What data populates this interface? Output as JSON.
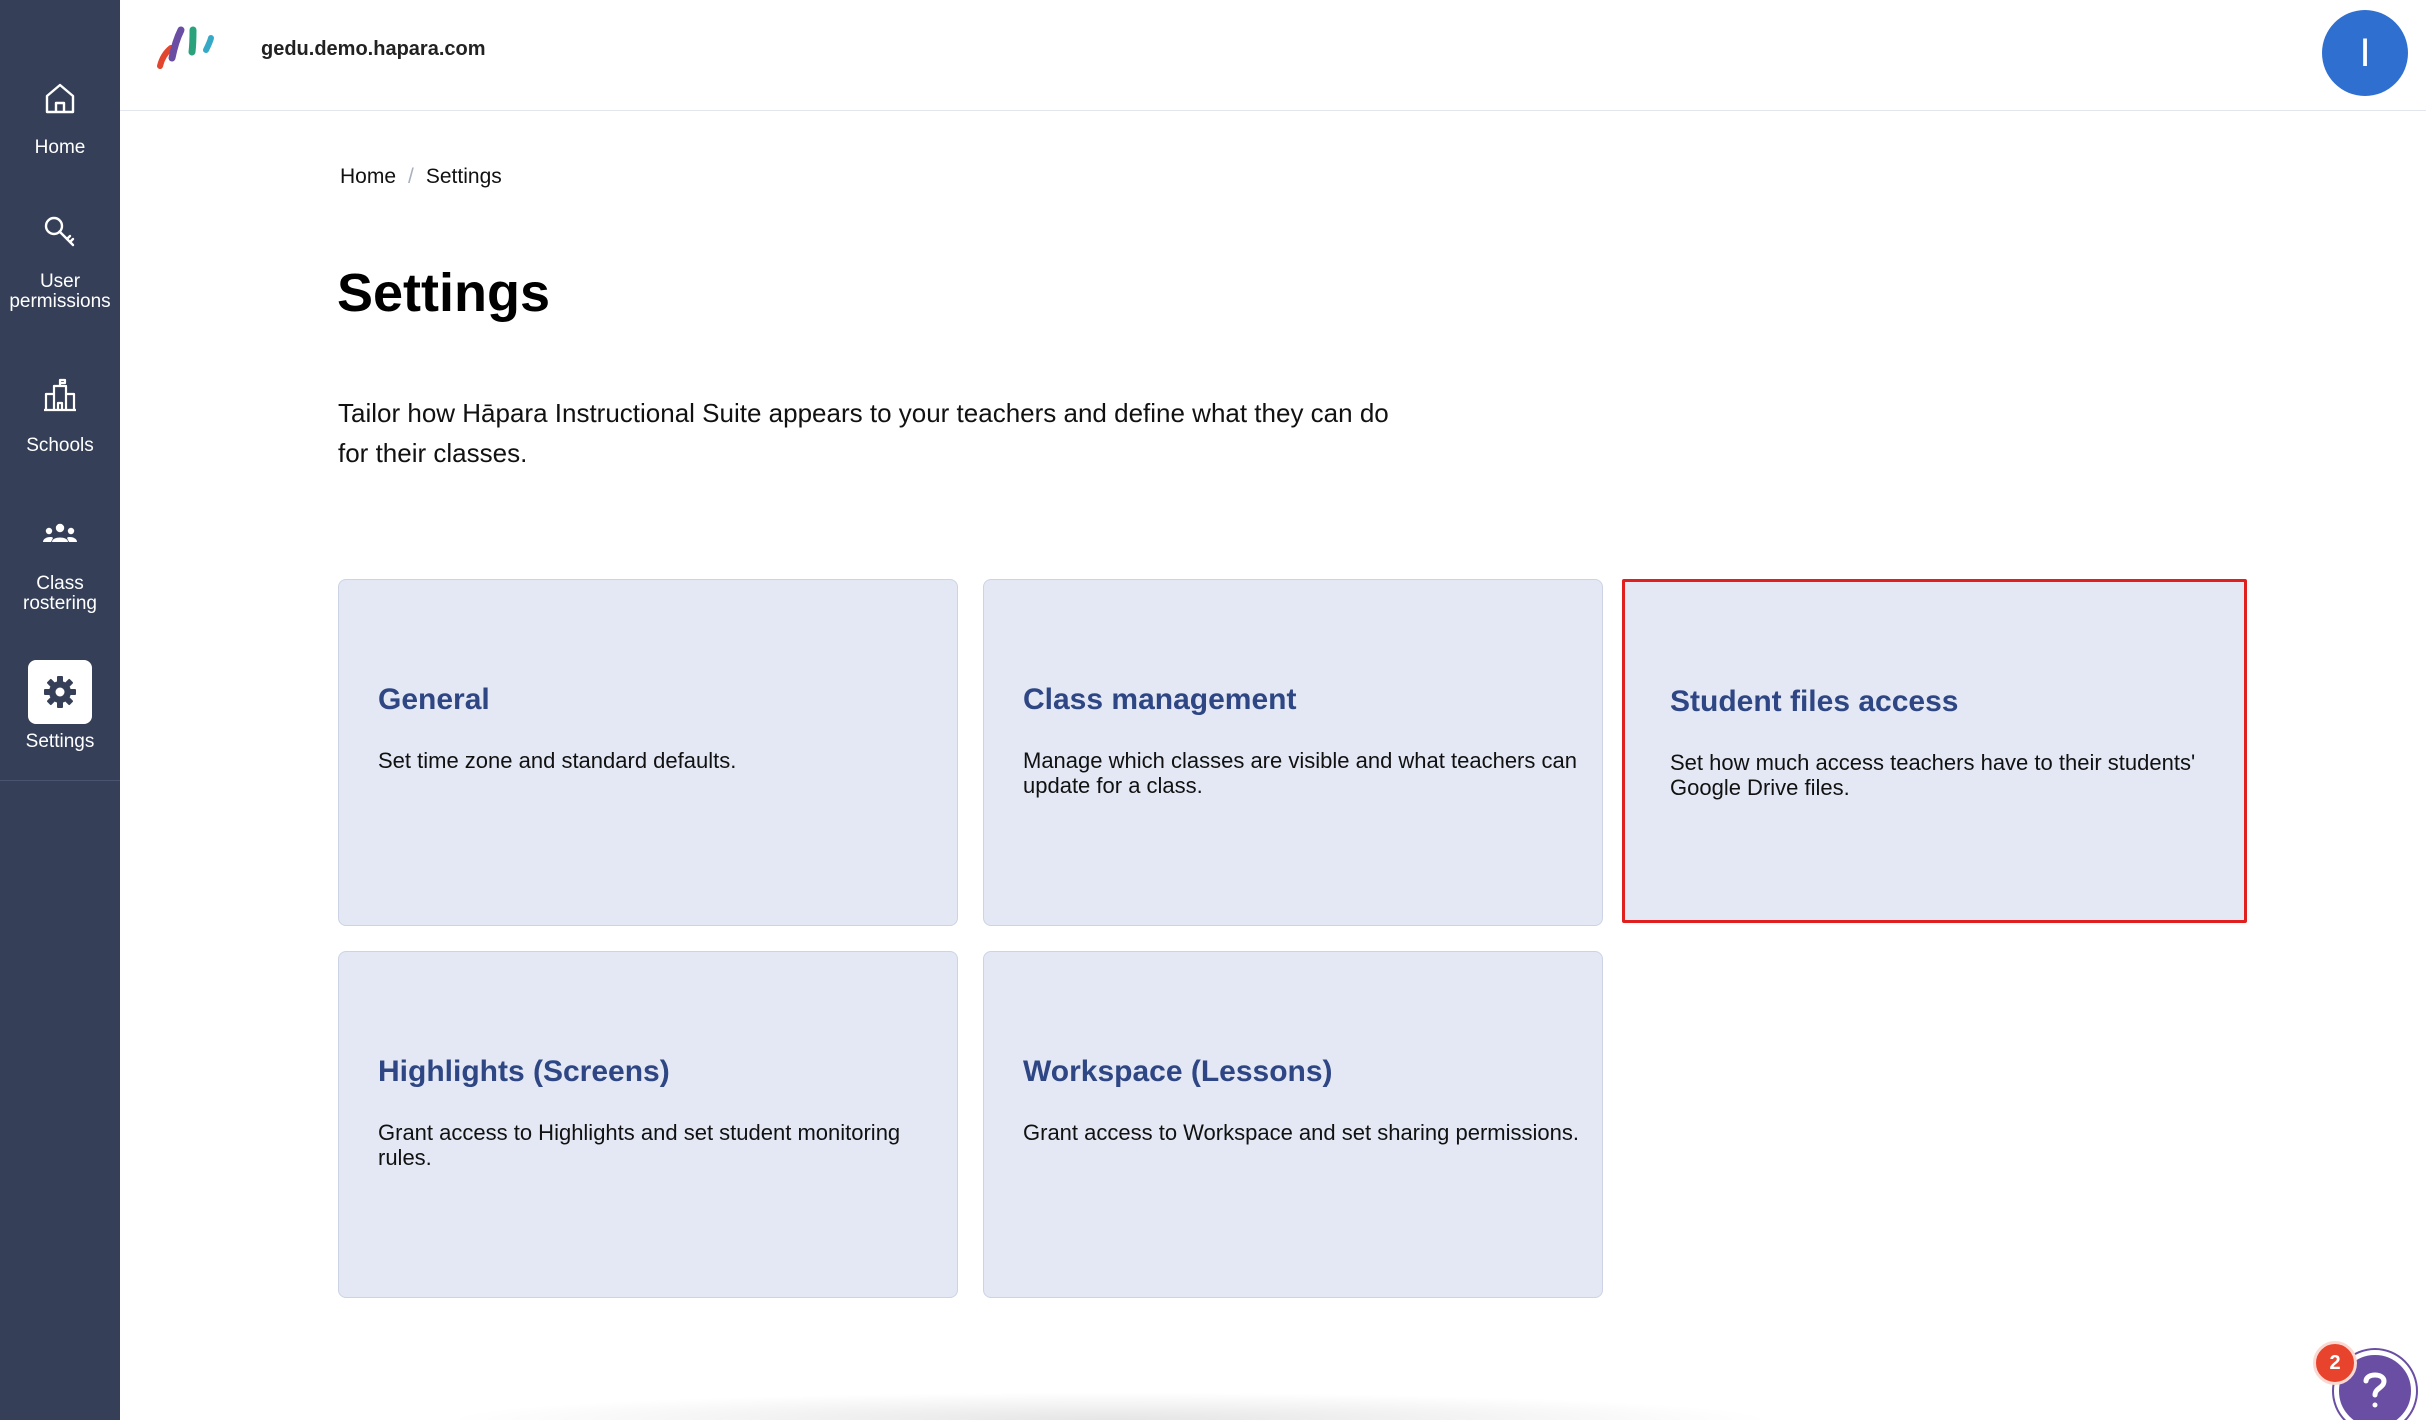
{
  "sidebar": {
    "items": [
      {
        "label": "Home",
        "icon": "home-icon"
      },
      {
        "label": "User permissions",
        "icon": "key-icon"
      },
      {
        "label": "Schools",
        "icon": "school-icon"
      },
      {
        "label": "Class rostering",
        "icon": "people-icon"
      },
      {
        "label": "Settings",
        "icon": "gear-icon",
        "active": true
      }
    ]
  },
  "header": {
    "domain": "gedu.demo.hapara.com",
    "avatar_initial": "I"
  },
  "breadcrumb": {
    "home": "Home",
    "separator": "/",
    "current": "Settings"
  },
  "page": {
    "title": "Settings",
    "description": "Tailor how Hāpara Instructional Suite appears to your teachers and define what they can do for their classes."
  },
  "cards": [
    {
      "title": "General",
      "description": "Set time zone and standard defaults."
    },
    {
      "title": "Class management",
      "description": "Manage which classes are visible and what teachers can update for a class."
    },
    {
      "title": "Student files access",
      "description": "Set how much access teachers have to their students' Google Drive files."
    },
    {
      "title": "Highlights (Screens)",
      "description": "Grant access to Highlights and set student monitoring rules."
    },
    {
      "title": "Workspace (Lessons)",
      "description": "Grant access to Workspace and set sharing permissions."
    }
  ],
  "help": {
    "badge_count": "2",
    "icon": "question-icon"
  },
  "colors": {
    "sidebar_bg": "#353f57",
    "card_bg": "#e3e8f4",
    "card_title": "#2e4683",
    "highlight_border": "#e01f1f",
    "avatar_bg": "#2f6fd0",
    "help_bg": "#6a4ea3",
    "badge_bg": "#e8442d"
  }
}
